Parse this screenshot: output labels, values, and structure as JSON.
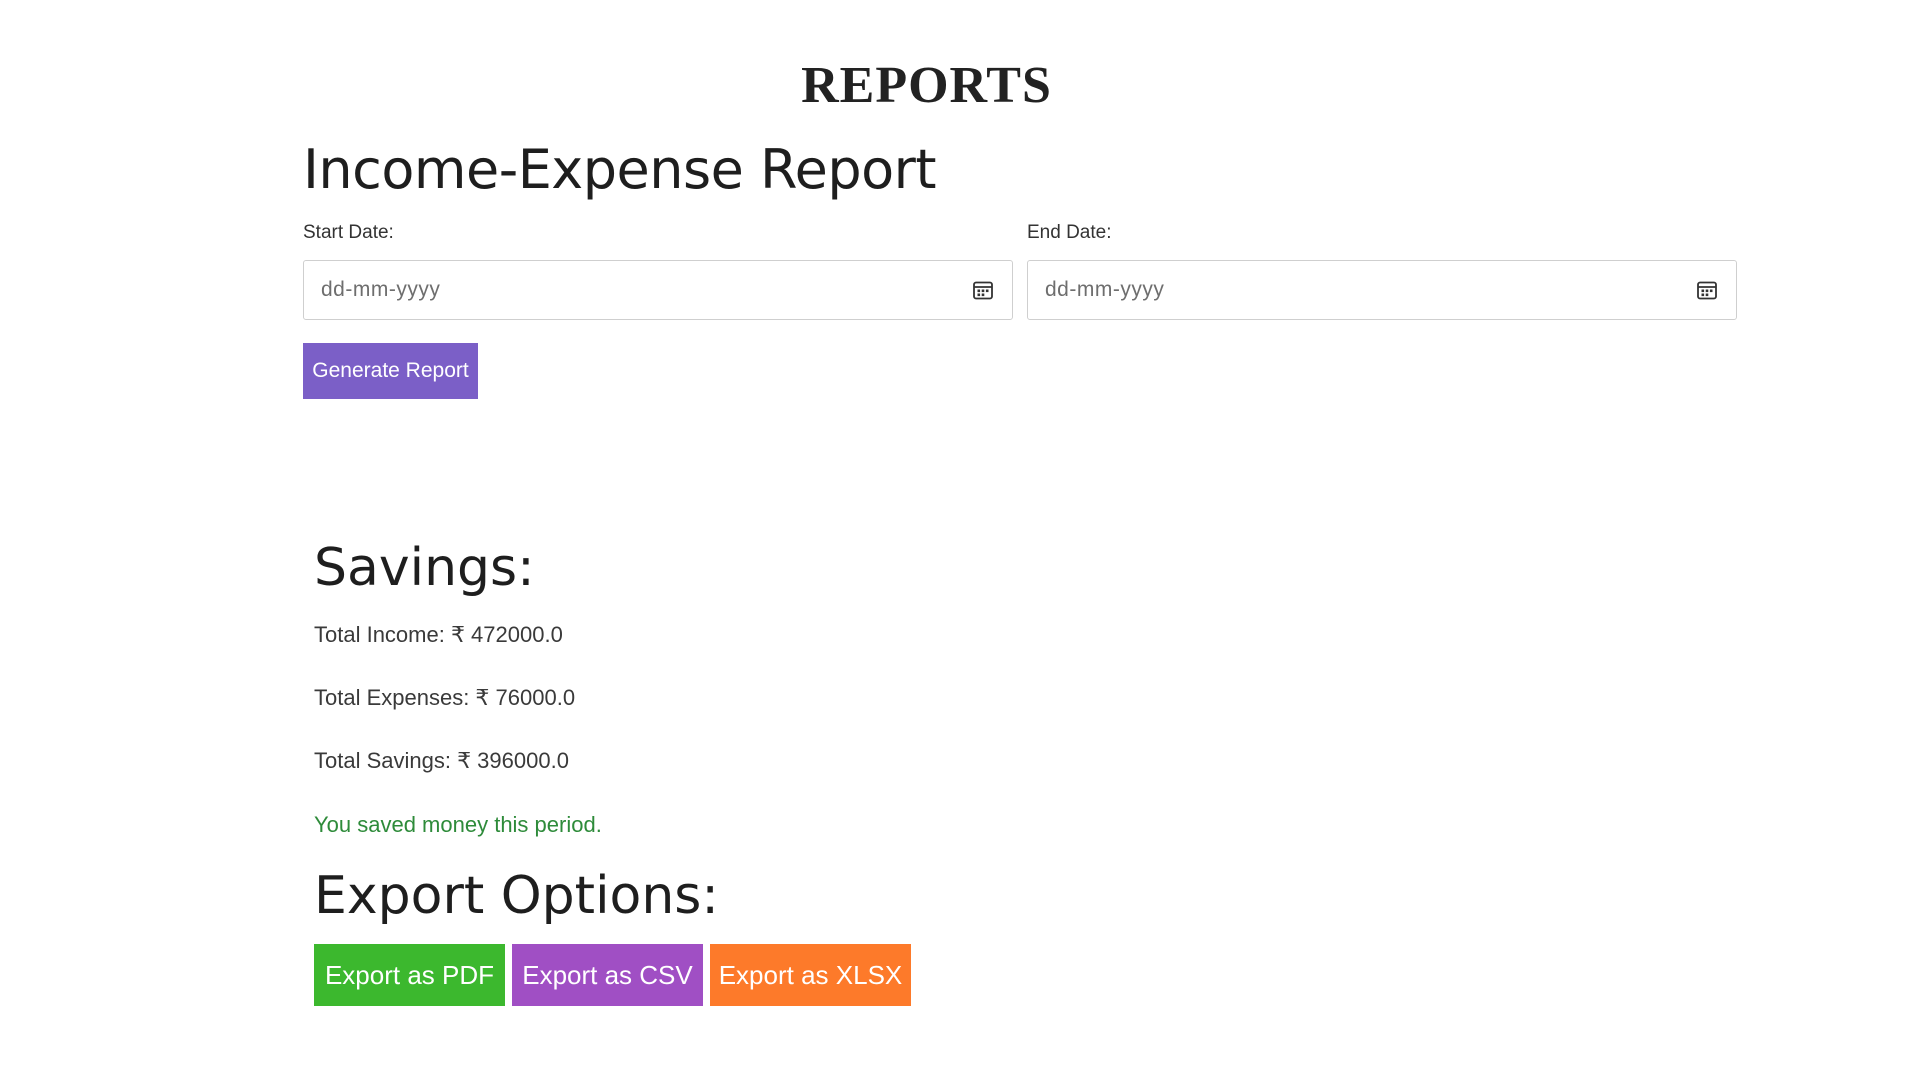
{
  "page": {
    "heading": "REPORTS"
  },
  "report": {
    "title": "Income-Expense Report",
    "start_date": {
      "label": "Start Date:",
      "placeholder": "dd-mm-yyyy",
      "icon": "calendar-icon"
    },
    "end_date": {
      "label": "End Date:",
      "placeholder": "dd-mm-yyyy",
      "icon": "calendar-icon"
    },
    "generate_label": "Generate Report",
    "generate_color": "#7b5fc7"
  },
  "savings": {
    "title": "Savings:",
    "total_income": "Total Income: ₹ 472000.0",
    "total_expenses": "Total Expenses: ₹ 76000.0",
    "total_savings": "Total Savings: ₹ 396000.0",
    "status_message": "You saved money this period.",
    "status_color": "#2e8b3a"
  },
  "export": {
    "title": "Export Options:",
    "buttons": [
      {
        "label": "Export as PDF",
        "color": "#3cb82e"
      },
      {
        "label": "Export as CSV",
        "color": "#a04fc4"
      },
      {
        "label": "Export as XLSX",
        "color": "#fd7a2a"
      }
    ]
  }
}
